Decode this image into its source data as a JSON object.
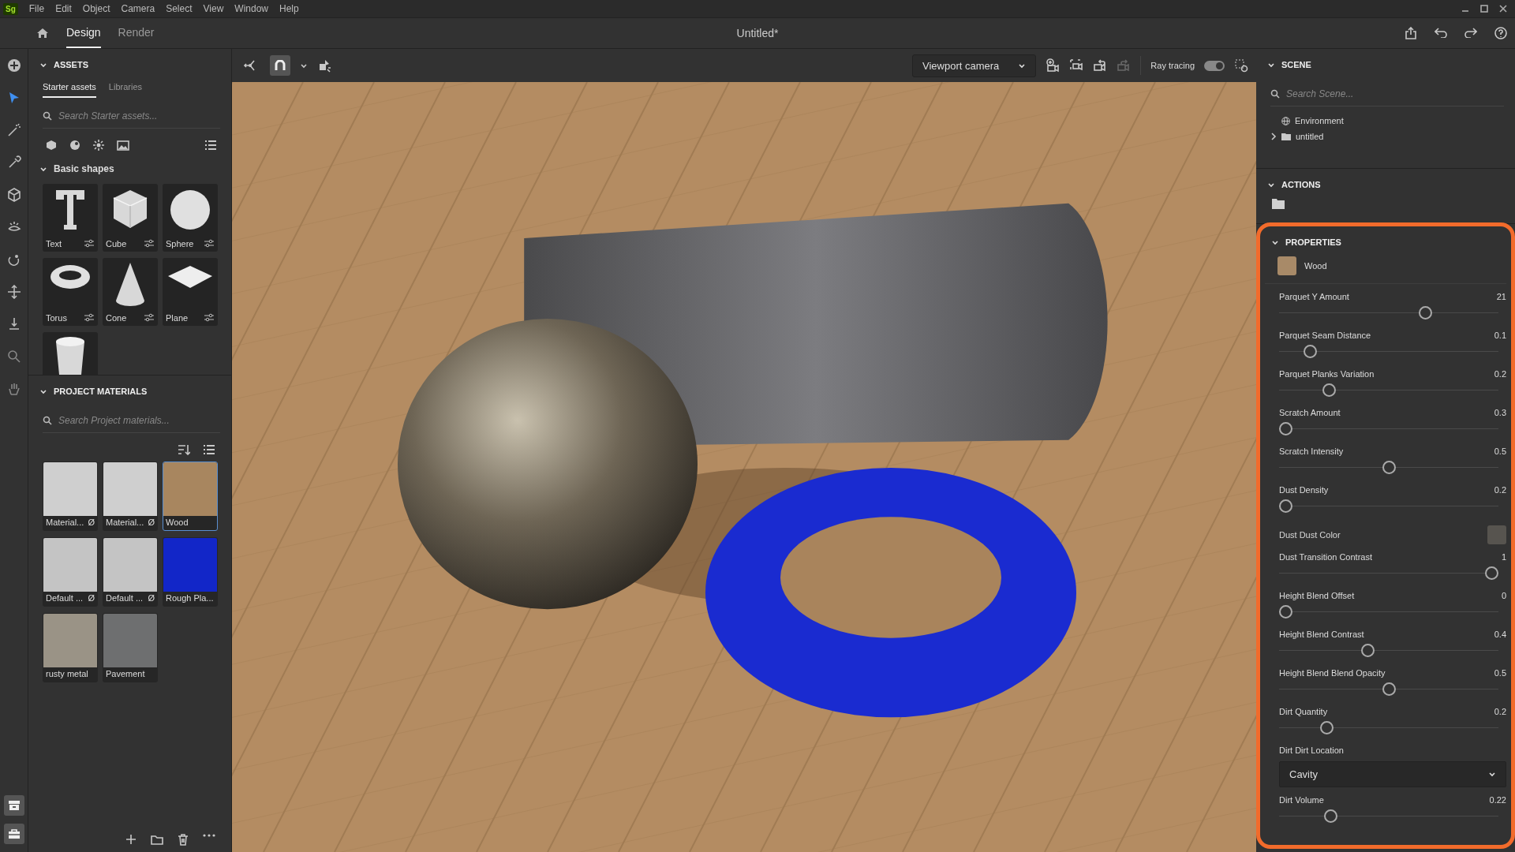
{
  "menu_bar": {
    "logo": "Sg",
    "items": [
      "File",
      "Edit",
      "Object",
      "Camera",
      "Select",
      "View",
      "Window",
      "Help"
    ]
  },
  "title_bar": {
    "tabs": [
      {
        "label": "Design",
        "selected": true
      },
      {
        "label": "Render",
        "selected": false
      }
    ],
    "document_title": "Untitled*"
  },
  "tool_strip": {
    "tools": [
      {
        "selected": false
      },
      {
        "selected": true
      },
      {
        "selected": false
      },
      {
        "selected": false
      },
      {
        "selected": false
      },
      {
        "selected": false
      },
      {
        "selected": false
      },
      {
        "selected": false
      },
      {
        "selected": false
      },
      {
        "selected": false
      },
      {
        "selected": false
      }
    ]
  },
  "assets": {
    "title": "ASSETS",
    "tabs": [
      {
        "label": "Starter assets",
        "selected": true
      },
      {
        "label": "Libraries",
        "selected": false
      }
    ],
    "search": {
      "placeholder": "Search Starter assets..."
    },
    "section": {
      "title": "Basic shapes",
      "items": [
        {
          "label": "Text",
          "cut_off": false
        },
        {
          "label": "Cube",
          "cut_off": false
        },
        {
          "label": "Sphere",
          "cut_off": false
        },
        {
          "label": "Torus",
          "cut_off": false
        },
        {
          "label": "Cone",
          "cut_off": false
        },
        {
          "label": "Plane",
          "cut_off": false
        },
        {
          "cut_off": true
        }
      ]
    }
  },
  "project_materials": {
    "title": "PROJECT MATERIALS",
    "search": {
      "placeholder": "Search Project materials..."
    },
    "materials": [
      {
        "label": "Material...",
        "badge": "Ø",
        "color": "#cfcfcf",
        "selected": false
      },
      {
        "label": "Material...",
        "badge": "Ø",
        "color": "#cfcfcf",
        "selected": false
      },
      {
        "label": "Wood",
        "color": "#a8865f",
        "selected": true
      },
      {
        "label": "Default ...",
        "badge": "Ø",
        "color": "#c4c4c4",
        "selected": false
      },
      {
        "label": "Default ...",
        "badge": "Ø",
        "color": "#c4c4c4",
        "selected": false
      },
      {
        "label": "Rough Pla...",
        "color": "#1226c8",
        "selected": false
      },
      {
        "label": "rusty metal",
        "color": "#9a9386",
        "selected": false
      },
      {
        "label": "Pavement",
        "color": "#6e6f70",
        "selected": false
      }
    ]
  },
  "viewport_toolbar": {
    "snap_selected": true,
    "camera": "Viewport camera",
    "camera_tools": [
      {
        "disabled": false
      },
      {
        "disabled": false
      },
      {
        "disabled": false
      },
      {
        "disabled": true
      }
    ],
    "ray_tracing": {
      "label": "Ray tracing",
      "on": true
    }
  },
  "scene": {
    "title": "SCENE",
    "search": {
      "placeholder": "Search Scene..."
    },
    "tree": [
      {
        "label": "Environment",
        "kind": "environment"
      },
      {
        "label": "untitled",
        "kind": "folder",
        "expanded": false
      }
    ]
  },
  "actions": {
    "title": "ACTIONS"
  },
  "properties": {
    "title": "PROPERTIES",
    "highlighted": true,
    "material": {
      "name": "Wood",
      "color": "#a88a68"
    },
    "params": [
      {
        "kind": "slider",
        "label": "Parquet Y Amount",
        "reading": "21",
        "level": 0.68
      },
      {
        "kind": "slider",
        "label": "Parquet Seam Distance",
        "reading": "0.1",
        "level": 0.12
      },
      {
        "kind": "slider",
        "label": "Parquet Planks Variation",
        "reading": "0.2",
        "level": 0.21
      },
      {
        "kind": "slider",
        "label": "Scratch Amount",
        "reading": "0.3",
        "level": 0
      },
      {
        "kind": "slider",
        "label": "Scratch Intensity",
        "reading": "0.5",
        "level": 0.5
      },
      {
        "kind": "slider",
        "label": "Dust Density",
        "reading": "0.2",
        "level": 0
      },
      {
        "kind": "color",
        "label": "Dust Dust Color",
        "color": "#57544f"
      },
      {
        "kind": "slider",
        "label": "Dust Transition Contrast",
        "reading": "1",
        "level": 1
      },
      {
        "kind": "slider",
        "label": "Height Blend Offset",
        "reading": "0",
        "level": 0
      },
      {
        "kind": "slider",
        "label": "Height Blend Contrast",
        "reading": "0.4",
        "level": 0.4
      },
      {
        "kind": "slider",
        "label": "Height Blend Blend Opacity",
        "reading": "0.5",
        "level": 0.5
      },
      {
        "kind": "slider",
        "label": "Dirt Quantity",
        "reading": "0.2",
        "level": 0.2
      },
      {
        "kind": "dropdown",
        "label": "Dirt Dirt Location",
        "value": "Cavity"
      },
      {
        "kind": "slider",
        "label": "Dirt Volume",
        "reading": "0.22",
        "level": 0.22
      }
    ]
  }
}
